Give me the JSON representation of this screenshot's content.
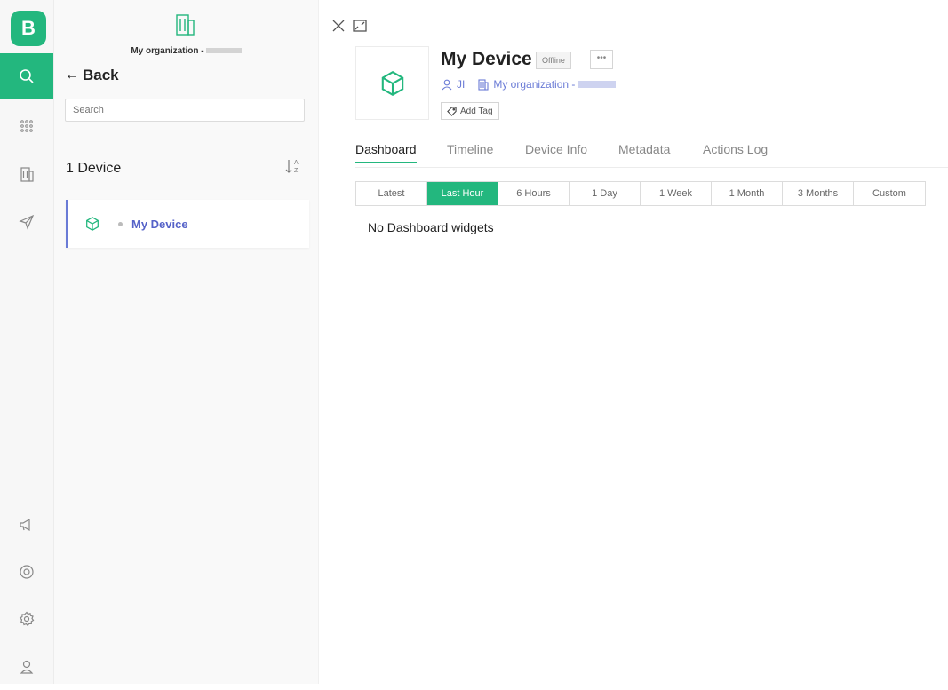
{
  "logo": "B",
  "rail": {
    "top_icons": [
      "search-icon",
      "grid-icon",
      "building-icon",
      "send-icon"
    ],
    "bottom_icons": [
      "megaphone-icon",
      "help-icon",
      "gear-icon",
      "user-icon"
    ]
  },
  "sidebar": {
    "org_name": "My organization -",
    "back_label": "Back",
    "search_placeholder": "Search",
    "device_count": "1 Device",
    "devices": [
      {
        "name": "My Device",
        "status": "offline"
      }
    ]
  },
  "device": {
    "name": "My Device",
    "status": "Offline",
    "more": "•••",
    "owner": "JI",
    "org": "My organization -",
    "add_tag": "Add Tag"
  },
  "tabs": [
    "Dashboard",
    "Timeline",
    "Device Info",
    "Metadata",
    "Actions Log"
  ],
  "ranges": [
    "Latest",
    "Last Hour",
    "6 Hours",
    "1 Day",
    "1 Week",
    "1 Month",
    "3 Months",
    "Custom"
  ],
  "active_range": "Last Hour",
  "empty_message": "No Dashboard widgets",
  "colors": {
    "accent": "#23b77e",
    "link": "#6a7bd6"
  }
}
